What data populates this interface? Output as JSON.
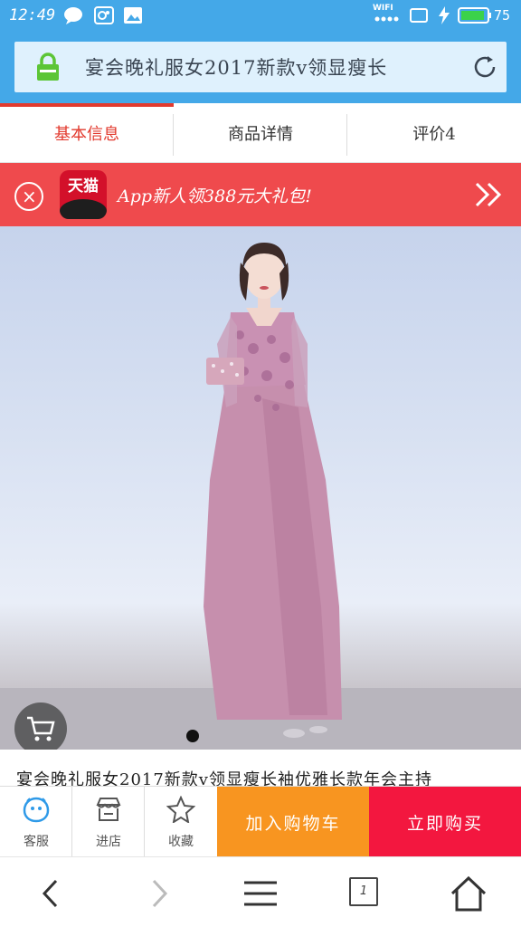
{
  "status_bar": {
    "time": "12:49",
    "wifi_label": "WIFI",
    "battery": "75"
  },
  "url_bar": {
    "title": "宴会晚礼服女2017新款v领显瘦长"
  },
  "tabs": [
    {
      "label": "基本信息",
      "active": true
    },
    {
      "label": "商品详情",
      "active": false
    },
    {
      "label": "评价4",
      "active": false
    }
  ],
  "promo": {
    "logo_text": "天猫",
    "text": "App新人领388元大礼包!"
  },
  "carousel": {
    "page_count": 2,
    "current_page": 1
  },
  "product": {
    "title": "宴会晚礼服女2017新款v领显瘦长袖优雅长款年会主持"
  },
  "actions": {
    "service_label": "客服",
    "store_label": "进店",
    "favorite_label": "收藏",
    "add_to_cart_label": "加入购物车",
    "buy_now_label": "立即购买"
  },
  "nav": {
    "tab_count": "1"
  },
  "colors": {
    "header": "#44a8e8",
    "tab_active": "#e23a2e",
    "promo_bg": "#ef4a4d",
    "add_to_cart": "#f89520",
    "buy_now": "#f3173f"
  }
}
